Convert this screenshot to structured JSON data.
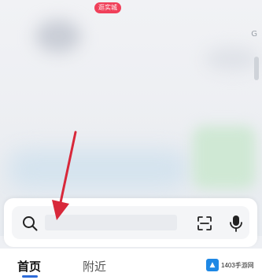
{
  "search": {
    "placeholder": "",
    "value": ""
  },
  "tabs": [
    {
      "label": "首页",
      "active": true
    },
    {
      "label": "附近",
      "active": false
    }
  ],
  "badge": {
    "label": "逛实城"
  },
  "watermark": {
    "logo_text": "1403",
    "text": "1403手游网"
  },
  "top_mark": "G",
  "colors": {
    "accent": "#2d6bd8",
    "badge": "#f0405a",
    "arrow": "#d8283a"
  },
  "icons": {
    "search": "search-icon",
    "scan": "scan-icon",
    "mic": "microphone-icon"
  }
}
